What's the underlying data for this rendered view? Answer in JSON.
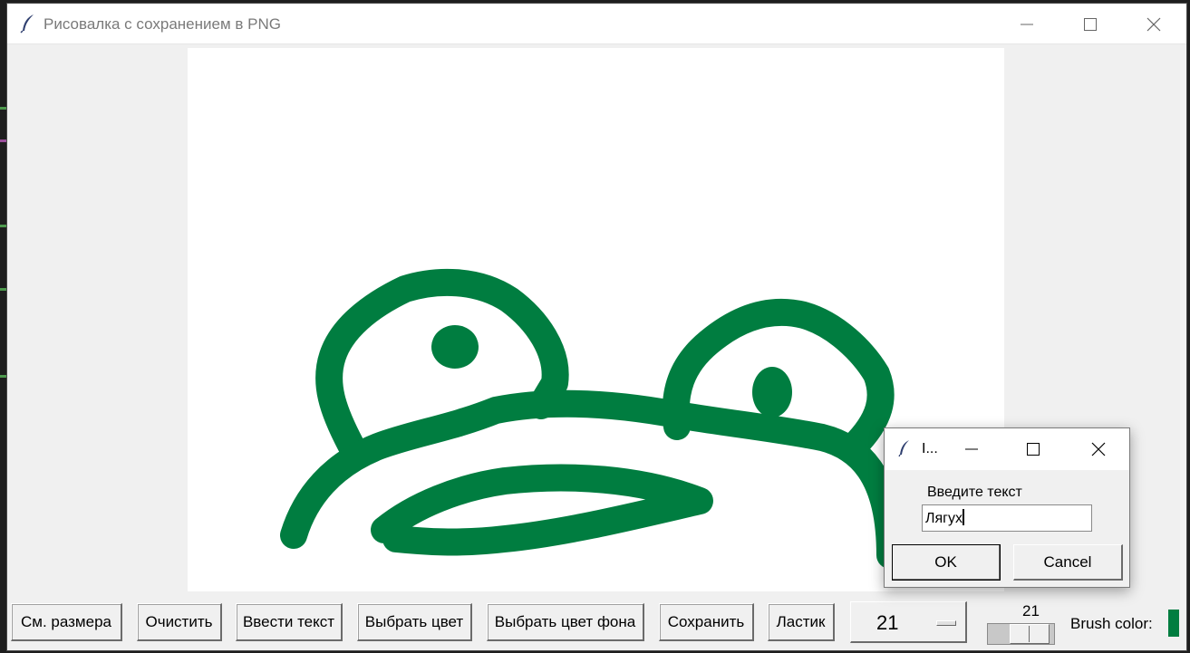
{
  "window": {
    "title": "Рисовалка с сохранением в PNG",
    "icon": "feather-icon",
    "controls": [
      "minimize-icon",
      "maximize-icon",
      "close-icon"
    ]
  },
  "canvas": {
    "background": "#ffffff",
    "stroke_color": "#007d40",
    "content": "green hand-drawn frog face: two eyes with pupils, head outline and mouth"
  },
  "toolbar": {
    "buttons": [
      {
        "id": "change-size",
        "label": "См. размера"
      },
      {
        "id": "clear",
        "label": "Очистить"
      },
      {
        "id": "enter-text",
        "label": "Ввести текст"
      },
      {
        "id": "choose-color",
        "label": "Выбрать цвет"
      },
      {
        "id": "choose-bg-color",
        "label": "Выбрать цвет фона"
      },
      {
        "id": "save",
        "label": "Сохранить"
      },
      {
        "id": "eraser",
        "label": "Ластик"
      }
    ],
    "size_select": {
      "value": "21"
    },
    "scale": {
      "value": "21"
    },
    "brush_color": {
      "label": "Brush color:",
      "color": "#007d40"
    }
  },
  "dialog": {
    "title": "I...",
    "prompt": "Введите текст",
    "input_value": "Лягух",
    "ok_label": "OK",
    "cancel_label": "Cancel"
  }
}
